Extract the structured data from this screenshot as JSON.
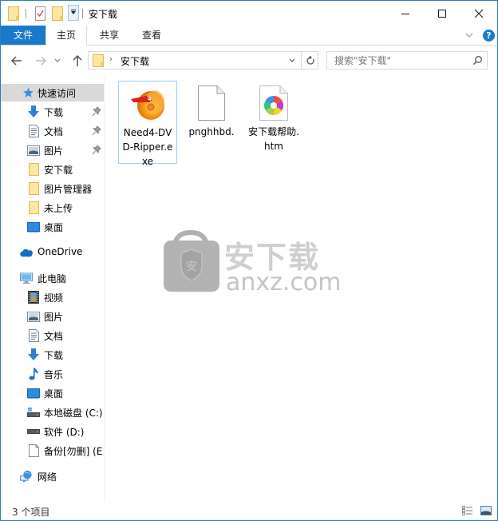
{
  "window": {
    "title": "安下载"
  },
  "ribbon": {
    "tabs": [
      {
        "label": "文件",
        "active_style": "file"
      },
      {
        "label": "主页"
      },
      {
        "label": "共享"
      },
      {
        "label": "查看"
      }
    ],
    "help_label": "?"
  },
  "navbar": {
    "address_path": [
      "安下载"
    ],
    "search_placeholder": "搜索\"安下载\""
  },
  "sidebar": {
    "quick_access": {
      "label": "快速访问",
      "items": [
        {
          "label": "下载",
          "icon": "download-arrow-icon",
          "pinned": true
        },
        {
          "label": "文档",
          "icon": "document-icon",
          "pinned": true
        },
        {
          "label": "图片",
          "icon": "pictures-icon",
          "pinned": true
        },
        {
          "label": "安下载",
          "icon": "folder-icon",
          "pinned": false
        },
        {
          "label": "图片管理器",
          "icon": "folder-icon",
          "pinned": false
        },
        {
          "label": "未上传",
          "icon": "folder-icon",
          "pinned": false
        },
        {
          "label": "桌面",
          "icon": "desktop-icon",
          "pinned": false
        }
      ]
    },
    "onedrive": {
      "label": "OneDrive"
    },
    "this_pc": {
      "label": "此电脑",
      "items": [
        {
          "label": "视频",
          "icon": "video-icon"
        },
        {
          "label": "图片",
          "icon": "pictures-icon"
        },
        {
          "label": "文档",
          "icon": "document-icon"
        },
        {
          "label": "下载",
          "icon": "download-arrow-icon"
        },
        {
          "label": "音乐",
          "icon": "music-note-icon"
        },
        {
          "label": "桌面",
          "icon": "desktop-icon"
        },
        {
          "label": "本地磁盘 (C:)",
          "icon": "system-drive-icon"
        },
        {
          "label": "软件 (D:)",
          "icon": "drive-icon"
        },
        {
          "label": "备份[勿删] (E:",
          "icon": "blank-file-icon"
        }
      ]
    },
    "network": {
      "label": "网络"
    }
  },
  "content": {
    "files": [
      {
        "name": "Need4-DVD-Ripper.exe",
        "icon": "dvd-ripper-app-icon",
        "selected": true
      },
      {
        "name": "pnghhbd.",
        "icon": "blank-file-icon",
        "selected": false
      },
      {
        "name": "安下载帮助.htm",
        "icon": "html-file-icon",
        "selected": false
      }
    ],
    "watermark": {
      "brand_cn": "安下载",
      "brand_url": "anxz.com",
      "shield_char": "安"
    }
  },
  "statusbar": {
    "item_count": "3 个项目"
  },
  "colors": {
    "accent": "#1979ca",
    "selection_border": "#99d1ff",
    "sidebar_selected": "#d9d9d9",
    "window_border": "#2b7fb8",
    "folder_yellow": "#f8d775"
  }
}
